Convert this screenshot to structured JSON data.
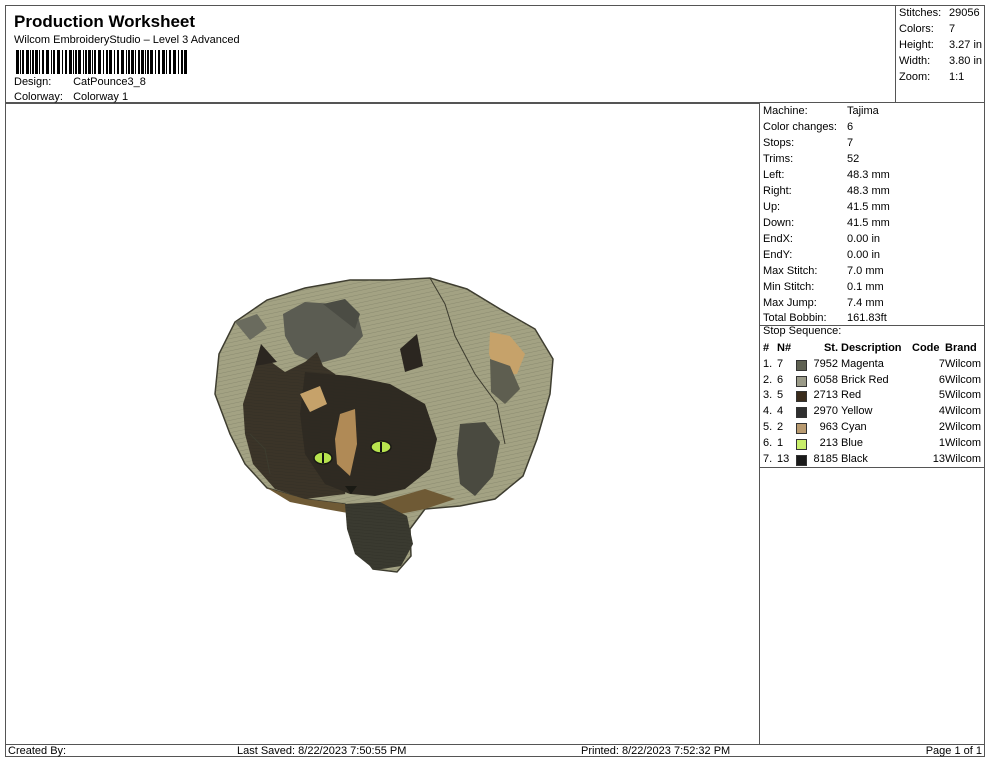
{
  "header": {
    "title": "Production Worksheet",
    "subtitle": "Wilcom EmbroideryStudio – Level 3 Advanced",
    "design_label": "Design:",
    "design_value": "CatPounce3_8",
    "colorway_label": "Colorway:",
    "colorway_value": "Colorway 1"
  },
  "summary": [
    {
      "label": "Stitches:",
      "value": "29056"
    },
    {
      "label": "Colors:",
      "value": "7"
    },
    {
      "label": "Height:",
      "value": "3.27 in"
    },
    {
      "label": "Width:",
      "value": "3.80 in"
    },
    {
      "label": "Zoom:",
      "value": "1:1"
    }
  ],
  "machine_info": [
    {
      "label": "Machine:",
      "value": "Tajima"
    },
    {
      "label": "Color changes:",
      "value": "6"
    },
    {
      "label": "Stops:",
      "value": "7"
    },
    {
      "label": "Trims:",
      "value": "52"
    },
    {
      "label": "Left:",
      "value": "48.3 mm"
    },
    {
      "label": "Right:",
      "value": "48.3 mm"
    },
    {
      "label": "Up:",
      "value": "41.5 mm"
    },
    {
      "label": "Down:",
      "value": "41.5 mm"
    },
    {
      "label": "EndX:",
      "value": "0.00 in"
    },
    {
      "label": "EndY:",
      "value": "0.00 in"
    },
    {
      "label": "Max Stitch:",
      "value": "7.0 mm"
    },
    {
      "label": "Min Stitch:",
      "value": "0.1 mm"
    },
    {
      "label": "Max Jump:",
      "value": "7.4 mm"
    },
    {
      "label": "Total Bobbin:",
      "value": "161.83ft"
    }
  ],
  "stop_sequence": {
    "title": "Stop Sequence:",
    "headers": {
      "num": "#",
      "n": "N#",
      "st": "St.",
      "desc": "Description",
      "code": "Code",
      "brand": "Brand"
    },
    "rows": [
      {
        "num": "1.",
        "n": "7",
        "color": "#5f6152",
        "st": "7952",
        "desc": "Magenta",
        "code": "7",
        "brand": "Wilcom"
      },
      {
        "num": "2.",
        "n": "6",
        "color": "#9a9a88",
        "st": "6058",
        "desc": "Brick Red",
        "code": "6",
        "brand": "Wilcom"
      },
      {
        "num": "3.",
        "n": "5",
        "color": "#3a2c1c",
        "st": "2713",
        "desc": "Red",
        "code": "5",
        "brand": "Wilcom"
      },
      {
        "num": "4.",
        "n": "4",
        "color": "#2f2f2f",
        "st": "2970",
        "desc": "Yellow",
        "code": "4",
        "brand": "Wilcom"
      },
      {
        "num": "5.",
        "n": "2",
        "color": "#b89a70",
        "st": "963",
        "desc": "Cyan",
        "code": "2",
        "brand": "Wilcom"
      },
      {
        "num": "6.",
        "n": "1",
        "color": "#c8ee6a",
        "st": "213",
        "desc": "Blue",
        "code": "1",
        "brand": "Wilcom"
      },
      {
        "num": "7.",
        "n": "13",
        "color": "#1a1a1a",
        "st": "8185",
        "desc": "Black",
        "code": "13",
        "brand": "Wilcom"
      }
    ]
  },
  "footer": {
    "created_by": "Created By:",
    "last_saved": "Last Saved: 8/22/2023 7:50:55 PM",
    "printed": "Printed: 8/22/2023 7:52:32 PM",
    "page": "Page 1 of 1"
  }
}
